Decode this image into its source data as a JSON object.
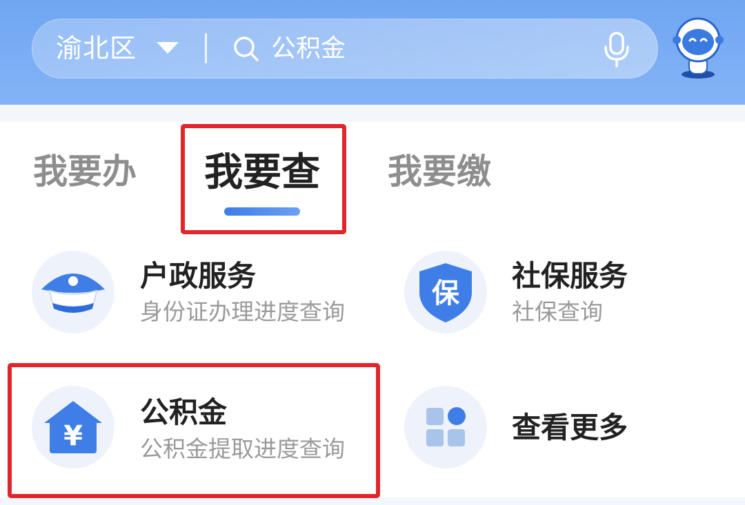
{
  "header": {
    "region": "渝北区",
    "search_text": "公积金"
  },
  "tabs": [
    {
      "label": "我要办",
      "active": false
    },
    {
      "label": "我要查",
      "active": true
    },
    {
      "label": "我要缴",
      "active": false
    }
  ],
  "services": [
    {
      "title": "户政服务",
      "subtitle": "身份证办理进度查询",
      "icon": "police-cap-icon"
    },
    {
      "title": "社保服务",
      "subtitle": "社保查询",
      "icon": "shield-bao-icon",
      "icon_glyph": "保"
    },
    {
      "title": "公积金",
      "subtitle": "公积金提取进度查询",
      "icon": "house-yuan-icon",
      "icon_glyph": "¥"
    },
    {
      "title": "查看更多",
      "icon": "grid-more-icon"
    }
  ],
  "colors": {
    "header_blue": "#6fa5f2",
    "accent_blue": "#3d7ce8",
    "highlight_red": "#e0262b"
  }
}
